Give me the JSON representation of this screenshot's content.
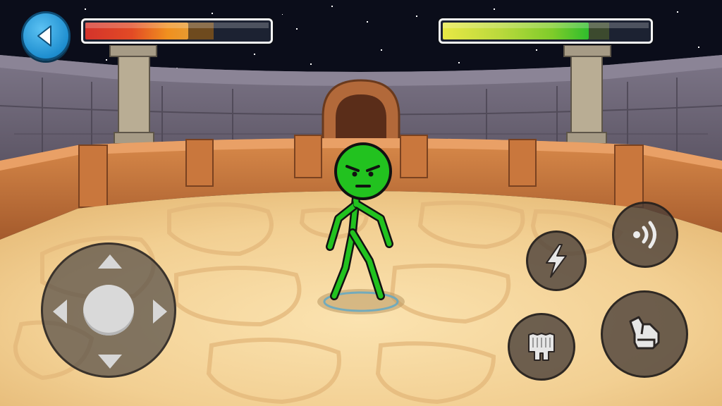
{
  "game": {
    "player_health": 0.56,
    "player_health_colors": [
      "#d4332b",
      "#f0901f"
    ],
    "enemy_health": 0.71,
    "enemy_health_colors": [
      "#e8e845",
      "#2fbd2d"
    ],
    "character_color": "#22c21f",
    "character_expression": "angry"
  },
  "controls": {
    "back": {
      "icon": "back-arrow-icon",
      "color": "#1f8fd0"
    },
    "joystick": {
      "icons": [
        "arrow-up-icon",
        "arrow-down-icon",
        "arrow-left-icon",
        "arrow-right-icon"
      ]
    },
    "buttons": [
      {
        "name": "sound",
        "icon": "sound-wave-icon"
      },
      {
        "name": "power",
        "icon": "lightning-icon"
      },
      {
        "name": "block",
        "icon": "shield-block-icon"
      },
      {
        "name": "punch",
        "icon": "fist-icon"
      }
    ]
  }
}
